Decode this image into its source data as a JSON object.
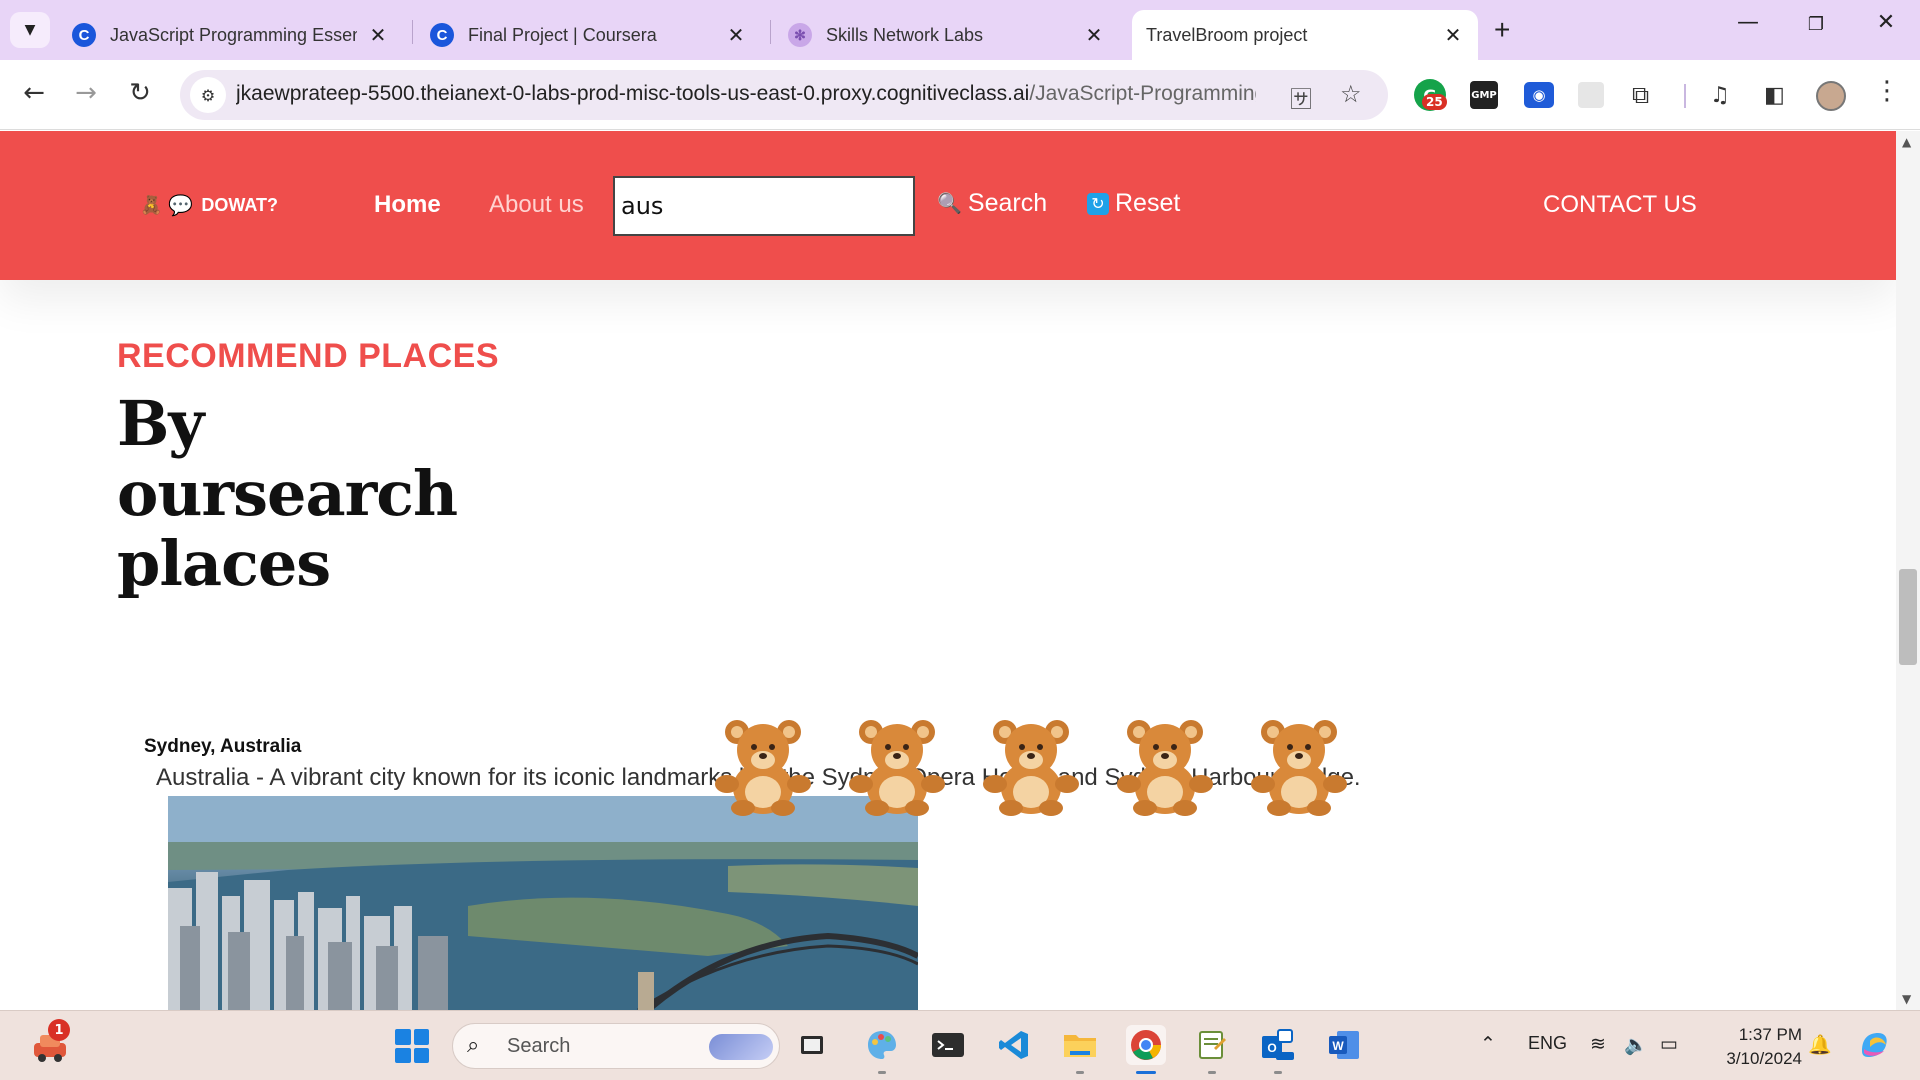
{
  "browser": {
    "tabs": [
      {
        "title": "JavaScript Programming Essenti",
        "favicon": "coursera-icon"
      },
      {
        "title": "Final Project | Coursera",
        "favicon": "coursera-icon"
      },
      {
        "title": "Skills Network Labs",
        "favicon": "skills-network-icon"
      },
      {
        "title": "TravelBroom project",
        "favicon": "teddy-bear-icon"
      }
    ],
    "active_tab": 3,
    "url_host": "jkaewprateep-5500.theianext-0-labs-prod-misc-tools-us-east-0.proxy.cognitiveclass.ai",
    "url_path": "/JavaScript-Programming...",
    "extension_badge": "25",
    "gmp_label": "GMP"
  },
  "site": {
    "logo_text": "DOWAT?",
    "nav": {
      "home": "Home",
      "about": "About us",
      "contact": "CONTACT US"
    },
    "search": {
      "value": "aus",
      "button": "Search",
      "reset": "Reset"
    },
    "accent_color": "#ef4e4c"
  },
  "section": {
    "kicker": "RECOMMEND PLACES",
    "title": "By oursearch places"
  },
  "result": {
    "name": "Sydney, Australia",
    "description": "Australia - A vibrant city known for its iconic landmarks like the Sydney Opera House and Sydney Harbour Bridge."
  },
  "taskbar": {
    "widget_badge": "1",
    "search_placeholder": "Search",
    "language": "ENG",
    "time": "1:37 PM",
    "date": "3/10/2024",
    "pinned_apps": [
      "task-view-icon",
      "paint-icon",
      "terminal-icon",
      "vscode-icon",
      "file-explorer-icon",
      "chrome-icon",
      "notepad-icon",
      "outlook-icon",
      "word-icon"
    ]
  }
}
